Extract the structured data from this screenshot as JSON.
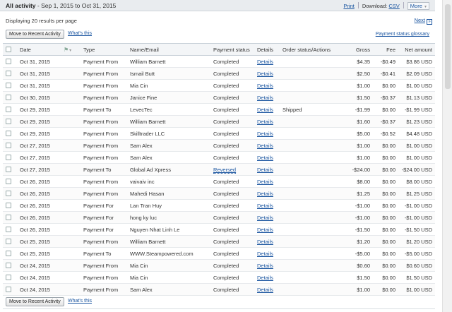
{
  "header": {
    "title": "All activity",
    "date_range": " - Sep 1, 2015 to Oct 31, 2015",
    "print": "Print",
    "download_label": "Download:",
    "csv": "CSV",
    "more": "More",
    "more_caret": "▾"
  },
  "results_info": "Displaying 20 results per page",
  "next": "Next",
  "next_icon": "»",
  "toolbar": {
    "move_button": "Move to Recent Activity",
    "whats_this": "What's this",
    "glossary": "Payment status glossary"
  },
  "columns": {
    "date": "Date",
    "type": "Type",
    "name": "Name/Email",
    "status": "Payment status",
    "details": "Details",
    "order": "Order status/Actions",
    "gross": "Gross",
    "fee": "Fee",
    "net": "Net amount"
  },
  "rows": [
    {
      "date": "Oct 31, 2015",
      "type": "Payment From",
      "name": "William Barnett",
      "status": "Completed",
      "details": "Details",
      "order": "",
      "gross": "$4.35",
      "fee": "-$0.49",
      "net": "$3.86 USD"
    },
    {
      "date": "Oct 31, 2015",
      "type": "Payment From",
      "name": "Ismail Butt",
      "status": "Completed",
      "details": "Details",
      "order": "",
      "gross": "$2.50",
      "fee": "-$0.41",
      "net": "$2.09 USD"
    },
    {
      "date": "Oct 31, 2015",
      "type": "Payment From",
      "name": "Mia Cin",
      "status": "Completed",
      "details": "Details",
      "order": "",
      "gross": "$1.00",
      "fee": "$0.00",
      "net": "$1.00 USD"
    },
    {
      "date": "Oct 30, 2015",
      "type": "Payment From",
      "name": "Janice Fine",
      "status": "Completed",
      "details": "Details",
      "order": "",
      "gross": "$1.50",
      "fee": "-$0.37",
      "net": "$1.13 USD"
    },
    {
      "date": "Oct 29, 2015",
      "type": "Payment To",
      "name": "LevecTec",
      "status": "Completed",
      "details": "Details",
      "order": "Shipped",
      "gross": "-$1.99",
      "fee": "$0.00",
      "net": "-$1.99 USD"
    },
    {
      "date": "Oct 29, 2015",
      "type": "Payment From",
      "name": "William Barnett",
      "status": "Completed",
      "details": "Details",
      "order": "",
      "gross": "$1.60",
      "fee": "-$0.37",
      "net": "$1.23 USD"
    },
    {
      "date": "Oct 29, 2015",
      "type": "Payment From",
      "name": "Skilltrader LLC",
      "status": "Completed",
      "details": "Details",
      "order": "",
      "gross": "$5.00",
      "fee": "-$0.52",
      "net": "$4.48 USD"
    },
    {
      "date": "Oct 27, 2015",
      "type": "Payment From",
      "name": "Sam Alex",
      "status": "Completed",
      "details": "Details",
      "order": "",
      "gross": "$1.00",
      "fee": "$0.00",
      "net": "$1.00 USD"
    },
    {
      "date": "Oct 27, 2015",
      "type": "Payment From",
      "name": "Sam Alex",
      "status": "Completed",
      "details": "Details",
      "order": "",
      "gross": "$1.00",
      "fee": "$0.00",
      "net": "$1.00 USD"
    },
    {
      "date": "Oct 27, 2015",
      "type": "Payment To",
      "name": "Global Ad Xpress",
      "status": "Reversed",
      "details": "Details",
      "order": "",
      "gross": "-$24.00",
      "fee": "$0.00",
      "net": "-$24.00 USD"
    },
    {
      "date": "Oct 26, 2015",
      "type": "Payment From",
      "name": "vaivaiv inc",
      "status": "Completed",
      "details": "Details",
      "order": "",
      "gross": "$8.00",
      "fee": "$0.00",
      "net": "$8.00 USD"
    },
    {
      "date": "Oct 26, 2015",
      "type": "Payment From",
      "name": "Mahedi Hasan",
      "status": "Completed",
      "details": "Details",
      "order": "",
      "gross": "$1.25",
      "fee": "$0.00",
      "net": "$1.25 USD"
    },
    {
      "date": "Oct 26, 2015",
      "type": "Payment For",
      "name": "Lan Tran Huy",
      "status": "Completed",
      "details": "Details",
      "order": "",
      "gross": "-$1.00",
      "fee": "$0.00",
      "net": "-$1.00 USD"
    },
    {
      "date": "Oct 26, 2015",
      "type": "Payment For",
      "name": "hong ky luc",
      "status": "Completed",
      "details": "Details",
      "order": "",
      "gross": "-$1.00",
      "fee": "$0.00",
      "net": "-$1.00 USD"
    },
    {
      "date": "Oct 26, 2015",
      "type": "Payment For",
      "name": "Nguyen Nhat Linh Le",
      "status": "Completed",
      "details": "Details",
      "order": "",
      "gross": "-$1.50",
      "fee": "$0.00",
      "net": "-$1.50 USD"
    },
    {
      "date": "Oct 25, 2015",
      "type": "Payment From",
      "name": "William Barnett",
      "status": "Completed",
      "details": "Details",
      "order": "",
      "gross": "$1.20",
      "fee": "$0.00",
      "net": "$1.20 USD"
    },
    {
      "date": "Oct 25, 2015",
      "type": "Payment To",
      "name": "WWW.Steampowered.com",
      "status": "Completed",
      "details": "Details",
      "order": "",
      "gross": "-$5.00",
      "fee": "$0.00",
      "net": "-$5.00 USD"
    },
    {
      "date": "Oct 24, 2015",
      "type": "Payment From",
      "name": "Mia Cin",
      "status": "Completed",
      "details": "Details",
      "order": "",
      "gross": "$0.60",
      "fee": "$0.00",
      "net": "$0.60 USD"
    },
    {
      "date": "Oct 24, 2015",
      "type": "Payment From",
      "name": "Mia Cin",
      "status": "Completed",
      "details": "Details",
      "order": "",
      "gross": "$1.50",
      "fee": "$0.00",
      "net": "$1.50 USD"
    },
    {
      "date": "Oct 24, 2015",
      "type": "Payment From",
      "name": "Sam Alex",
      "status": "Completed",
      "details": "Details",
      "order": "",
      "gross": "$1.00",
      "fee": "$0.00",
      "net": "$1.00 USD"
    }
  ]
}
